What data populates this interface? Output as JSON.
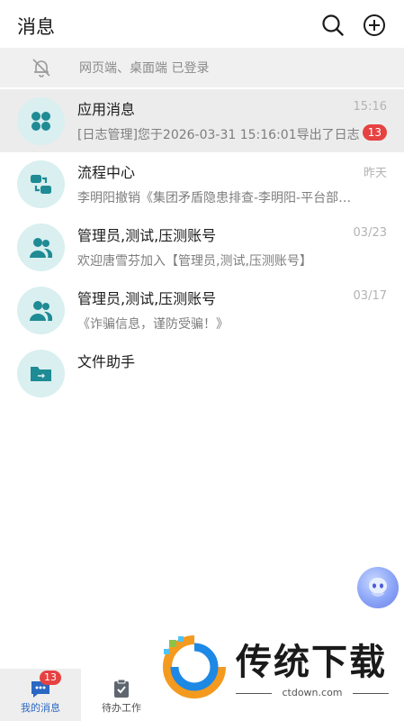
{
  "header": {
    "title": "消息",
    "search_icon": "search-icon",
    "add_icon": "plus-circle-icon"
  },
  "login_status": {
    "text": "网页端、桌面端 已登录",
    "icon": "bell-off-icon"
  },
  "messages": [
    {
      "name": "应用消息",
      "time": "15:16",
      "preview": "[日志管理]您于2026-03-31 15:16:01导出了日志",
      "badge": "13",
      "icon": "apps-grid-icon"
    },
    {
      "name": "流程中心",
      "time": "昨天",
      "preview": "李明阳撤销《集团矛盾隐患排查-李明阳-平台部门》",
      "badge": "",
      "icon": "workflow-icon"
    },
    {
      "name": "管理员,测试,压测账号",
      "time": "03/23",
      "preview": "欢迎唐雪芬加入【管理员,测试,压测账号】",
      "badge": "",
      "icon": "group-icon"
    },
    {
      "name": "管理员,测试,压测账号",
      "time": "03/17",
      "preview": "《诈骗信息，谨防受骗！》",
      "badge": "",
      "icon": "group-icon"
    },
    {
      "name": "文件助手",
      "time": "",
      "preview": "",
      "badge": "",
      "icon": "folder-icon"
    }
  ],
  "tabbar": {
    "tabs": [
      {
        "label": "我的消息",
        "badge": "13",
        "icon": "chat-icon"
      },
      {
        "label": "待办工作",
        "badge": "",
        "icon": "clipboard-check-icon"
      }
    ]
  },
  "watermark": {
    "text": "传统下载",
    "url": "ctdown.com"
  },
  "colors": {
    "accent": "#2a67c2",
    "avatar_bg": "#d9eff0",
    "avatar_fg": "#1f8b94",
    "badge": "#e64242"
  }
}
